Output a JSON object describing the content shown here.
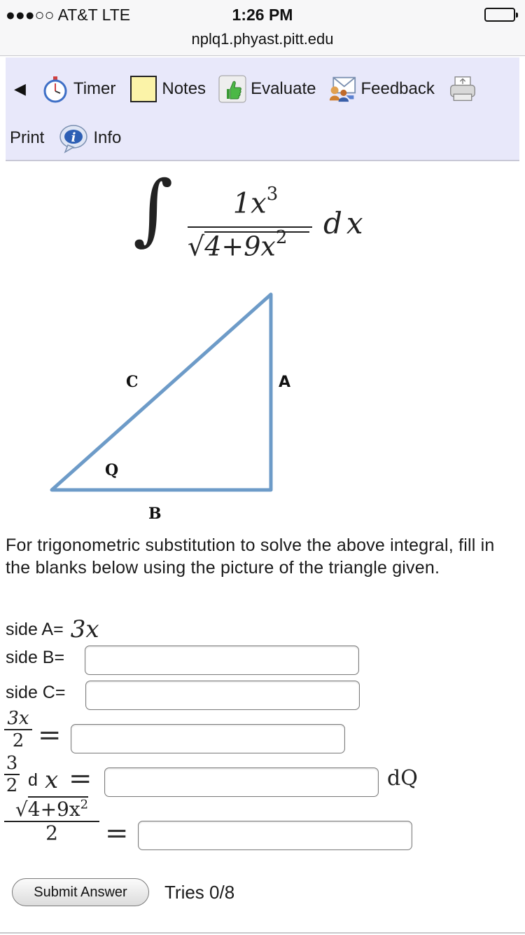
{
  "status_bar": {
    "carrier": "●●●○○ AT&T  LTE",
    "time": "1:26 PM",
    "url": "nplq1.phyast.pitt.edu"
  },
  "toolbar": {
    "back_icon": "back-arrow-icon",
    "items": [
      {
        "label": "Timer",
        "icon": "stopwatch-icon"
      },
      {
        "label": "Notes",
        "icon": "notepad-icon"
      },
      {
        "label": "Evaluate",
        "icon": "thumbs-up-icon"
      },
      {
        "label": "Feedback",
        "icon": "feedback-icon"
      },
      {
        "label": "Print",
        "icon": "printer-icon"
      },
      {
        "label": "Info",
        "icon": "info-icon"
      }
    ]
  },
  "integral": {
    "numerator": "1x",
    "numerator_exp": "3",
    "denominator": "4+9x",
    "denominator_exp": "2",
    "differential": "dx"
  },
  "triangle": {
    "label_A": "A",
    "label_B": "B",
    "label_C": "C",
    "label_angle": "Q"
  },
  "problem_text": "For trigonometric substitution to solve the above integral, fill in the blanks below using the picture of the triangle given.",
  "fields": {
    "side_a_label": "side A=",
    "side_a_value": "3x",
    "side_b_label": "side B=",
    "side_b_value": "",
    "side_c_label": "side C=",
    "side_c_value": "",
    "frac1_num": "3x",
    "frac1_den": "2",
    "frac1_value": "",
    "frac2_num": "3",
    "frac2_den": "2",
    "frac2_mid": "d",
    "frac2_var": "x",
    "frac2_value": "",
    "frac2_suffix": "dQ",
    "frac3_num": "4+9x",
    "frac3_exp": "2",
    "frac3_den": "2",
    "frac3_value": ""
  },
  "submit": {
    "label": "Submit Answer",
    "tries": "Tries 0/8"
  },
  "colors": {
    "toolbar_bg": "#e8e8fa",
    "triangle_stroke": "#6d9bc8"
  }
}
